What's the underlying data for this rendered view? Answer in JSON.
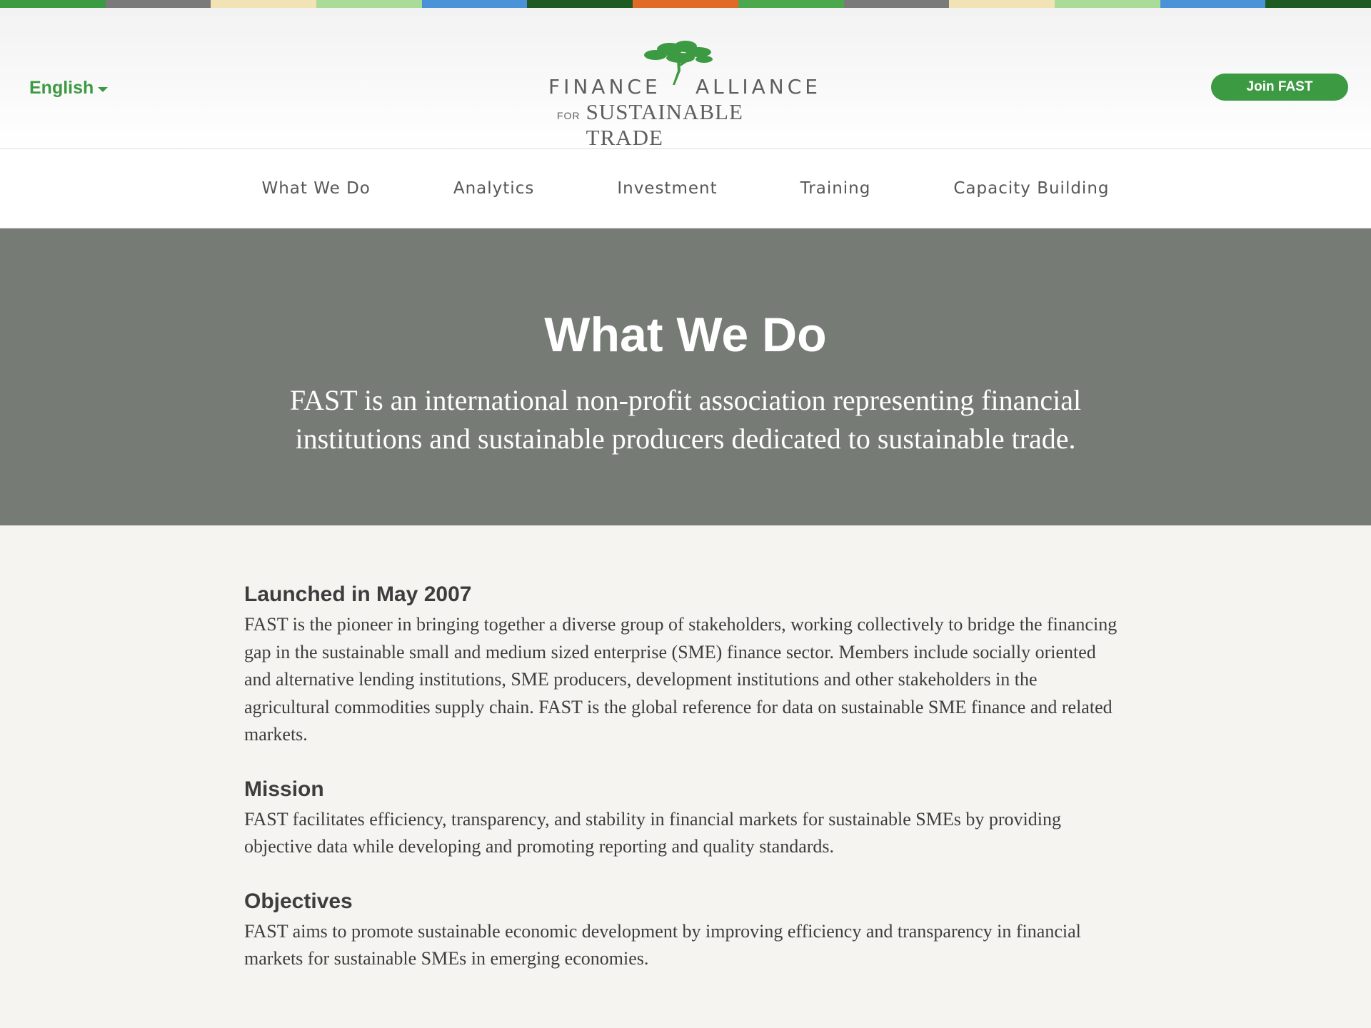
{
  "top_stripes": [
    "#3c9a42",
    "#7a7a7a",
    "#f2e3b5",
    "#a8dc98",
    "#4a92d8",
    "#1f5a22",
    "#e06a26",
    "#4ca84c",
    "#7a7a7a",
    "#f2e3b5",
    "#a8dc98",
    "#4a92d8",
    "#1f5a22"
  ],
  "header": {
    "language": "English",
    "logo": {
      "line1_word1": "FINANCE",
      "line1_word2": "ALLIANCE",
      "line2_for": "FOR",
      "line2_main": "SUSTAINABLE TRADE"
    },
    "join_button": "Join FAST"
  },
  "nav": {
    "items": [
      {
        "label": "What We Do"
      },
      {
        "label": "Analytics"
      },
      {
        "label": "Investment"
      },
      {
        "label": "Training"
      },
      {
        "label": "Capacity Building"
      }
    ]
  },
  "hero": {
    "title": "What We Do",
    "subtitle": "FAST is an international non-profit association representing financial institutions and sustainable producers dedicated to sustainable trade."
  },
  "sections": [
    {
      "heading": "Launched in May 2007",
      "body": "FAST is the pioneer in bringing together a diverse group of stakeholders, working collectively to bridge the financing gap in the sustainable small and medium sized enterprise (SME) finance sector. Members include socially oriented and alternative lending institutions, SME producers, development institutions and other stakeholders in the agricultural commodities supply chain. FAST is the global reference for data on sustainable SME finance and related markets."
    },
    {
      "heading": "Mission",
      "body": "FAST facilitates efficiency, transparency, and stability in financial markets for sustainable SMEs by providing objective data while developing and promoting reporting and quality standards."
    },
    {
      "heading": "Objectives",
      "body": "FAST aims to promote sustainable economic development by improving efficiency and transparency in financial markets for sustainable SMEs in emerging economies."
    }
  ],
  "colors": {
    "brand_green": "#3c9a42",
    "hero_bg": "#777b76",
    "text": "#3d3d3d"
  }
}
